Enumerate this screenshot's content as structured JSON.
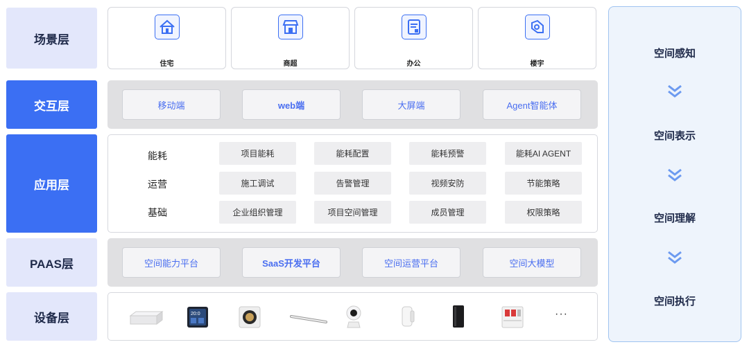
{
  "layers": {
    "scene": "场景层",
    "interaction": "交互层",
    "application": "应用层",
    "paas": "PAAS层",
    "device": "设备层"
  },
  "scenes": [
    {
      "label": "住宅",
      "icon": "house-icon"
    },
    {
      "label": "商超",
      "icon": "store-icon"
    },
    {
      "label": "办公",
      "icon": "office-document-icon"
    },
    {
      "label": "楼宇",
      "icon": "building-icon"
    }
  ],
  "interaction": [
    "移动端",
    "web端",
    "大屏端",
    "Agent智能体"
  ],
  "application": {
    "rows": [
      {
        "label": "能耗",
        "items": [
          "项目能耗",
          "能耗配置",
          "能耗预警",
          "能耗AI AGENT"
        ]
      },
      {
        "label": "运营",
        "items": [
          "施工调试",
          "告警管理",
          "视频安防",
          "节能策略"
        ]
      },
      {
        "label": "基础",
        "items": [
          "企业组织管理",
          "项目空间管理",
          "成员管理",
          "权限策略"
        ]
      }
    ]
  },
  "paas": [
    "空间能力平台",
    "SaaS开发平台",
    "空间运营平台",
    "空间大模型"
  ],
  "devices": {
    "icons": [
      "gateway-icon",
      "smart-panel-icon",
      "thermostat-icon",
      "linear-light-icon",
      "camera-icon",
      "sensor-icon",
      "speaker-icon",
      "circuit-breaker-icon"
    ],
    "more": "···",
    "panel_screen_text": "20:0"
  },
  "right_column": [
    "空间感知",
    "空间表示",
    "空间理解",
    "空间执行"
  ],
  "colors": {
    "accent": "#3b6ff3",
    "light_label": "#e3e7fb",
    "gray_panel": "#e0e0e2"
  }
}
